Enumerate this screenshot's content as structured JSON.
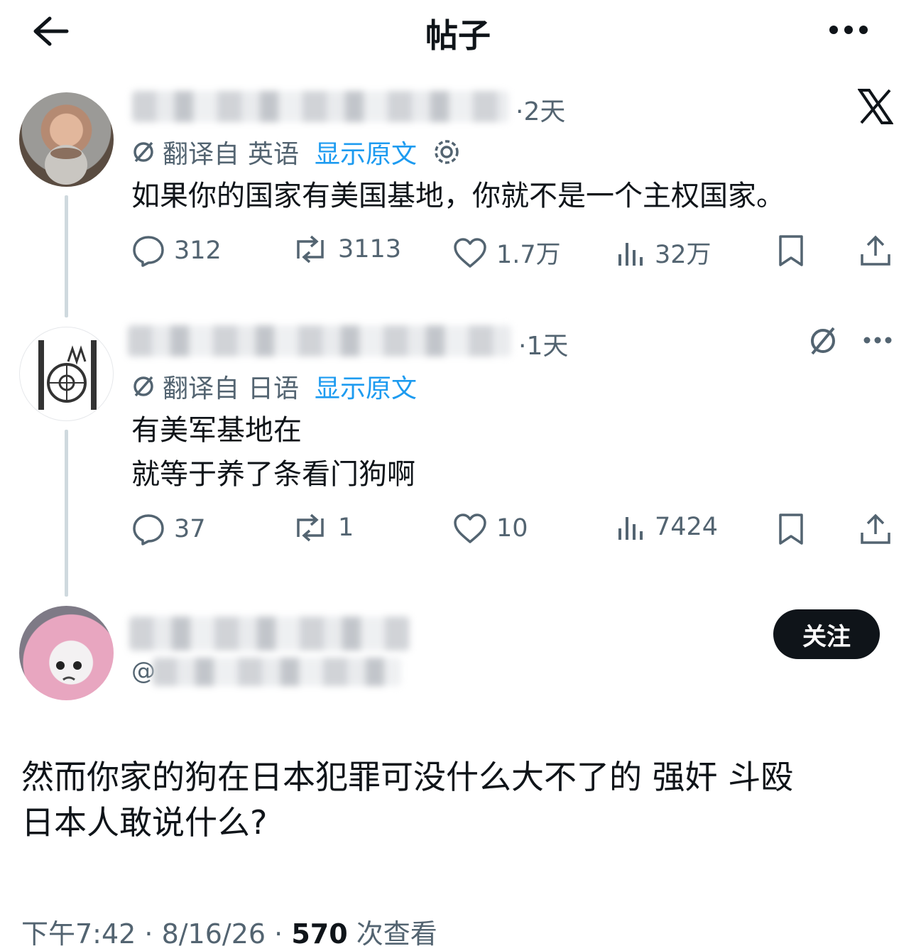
{
  "header": {
    "title": "帖子",
    "back_icon": "arrow-left-icon",
    "more_icon": "more-horizontal-icon"
  },
  "post1": {
    "time": "·2天",
    "translate": {
      "prefix": "翻译自",
      "lang": "英语",
      "show_original": "显示原文"
    },
    "text": "如果你的国家有美国基地，你就不是一个主权国家。",
    "stats": {
      "replies": "312",
      "reposts": "3113",
      "likes": "1.7万",
      "views": "32万"
    }
  },
  "post2": {
    "time": "·1天",
    "translate": {
      "prefix": "翻译自",
      "lang": "日语",
      "show_original": "显示原文"
    },
    "text": "有美军基地在\n就等于养了条看门狗啊",
    "stats": {
      "replies": "37",
      "reposts": "1",
      "likes": "10",
      "views": "7424"
    }
  },
  "main_post": {
    "handle_prefix": "@",
    "follow_label": "关注",
    "text": "然而你家的狗在日本犯罪可没什么大不了的 强奸 斗殴\n日本人敢说什么?",
    "footer_time": "下午7:42 · 8/16/26 · ",
    "footer_views": "570",
    "footer_views_label": " 次查看"
  },
  "colors": {
    "text": "#0f1419",
    "secondary": "#536471",
    "link": "#1d9bf0",
    "thread_line": "#cfd9de"
  }
}
